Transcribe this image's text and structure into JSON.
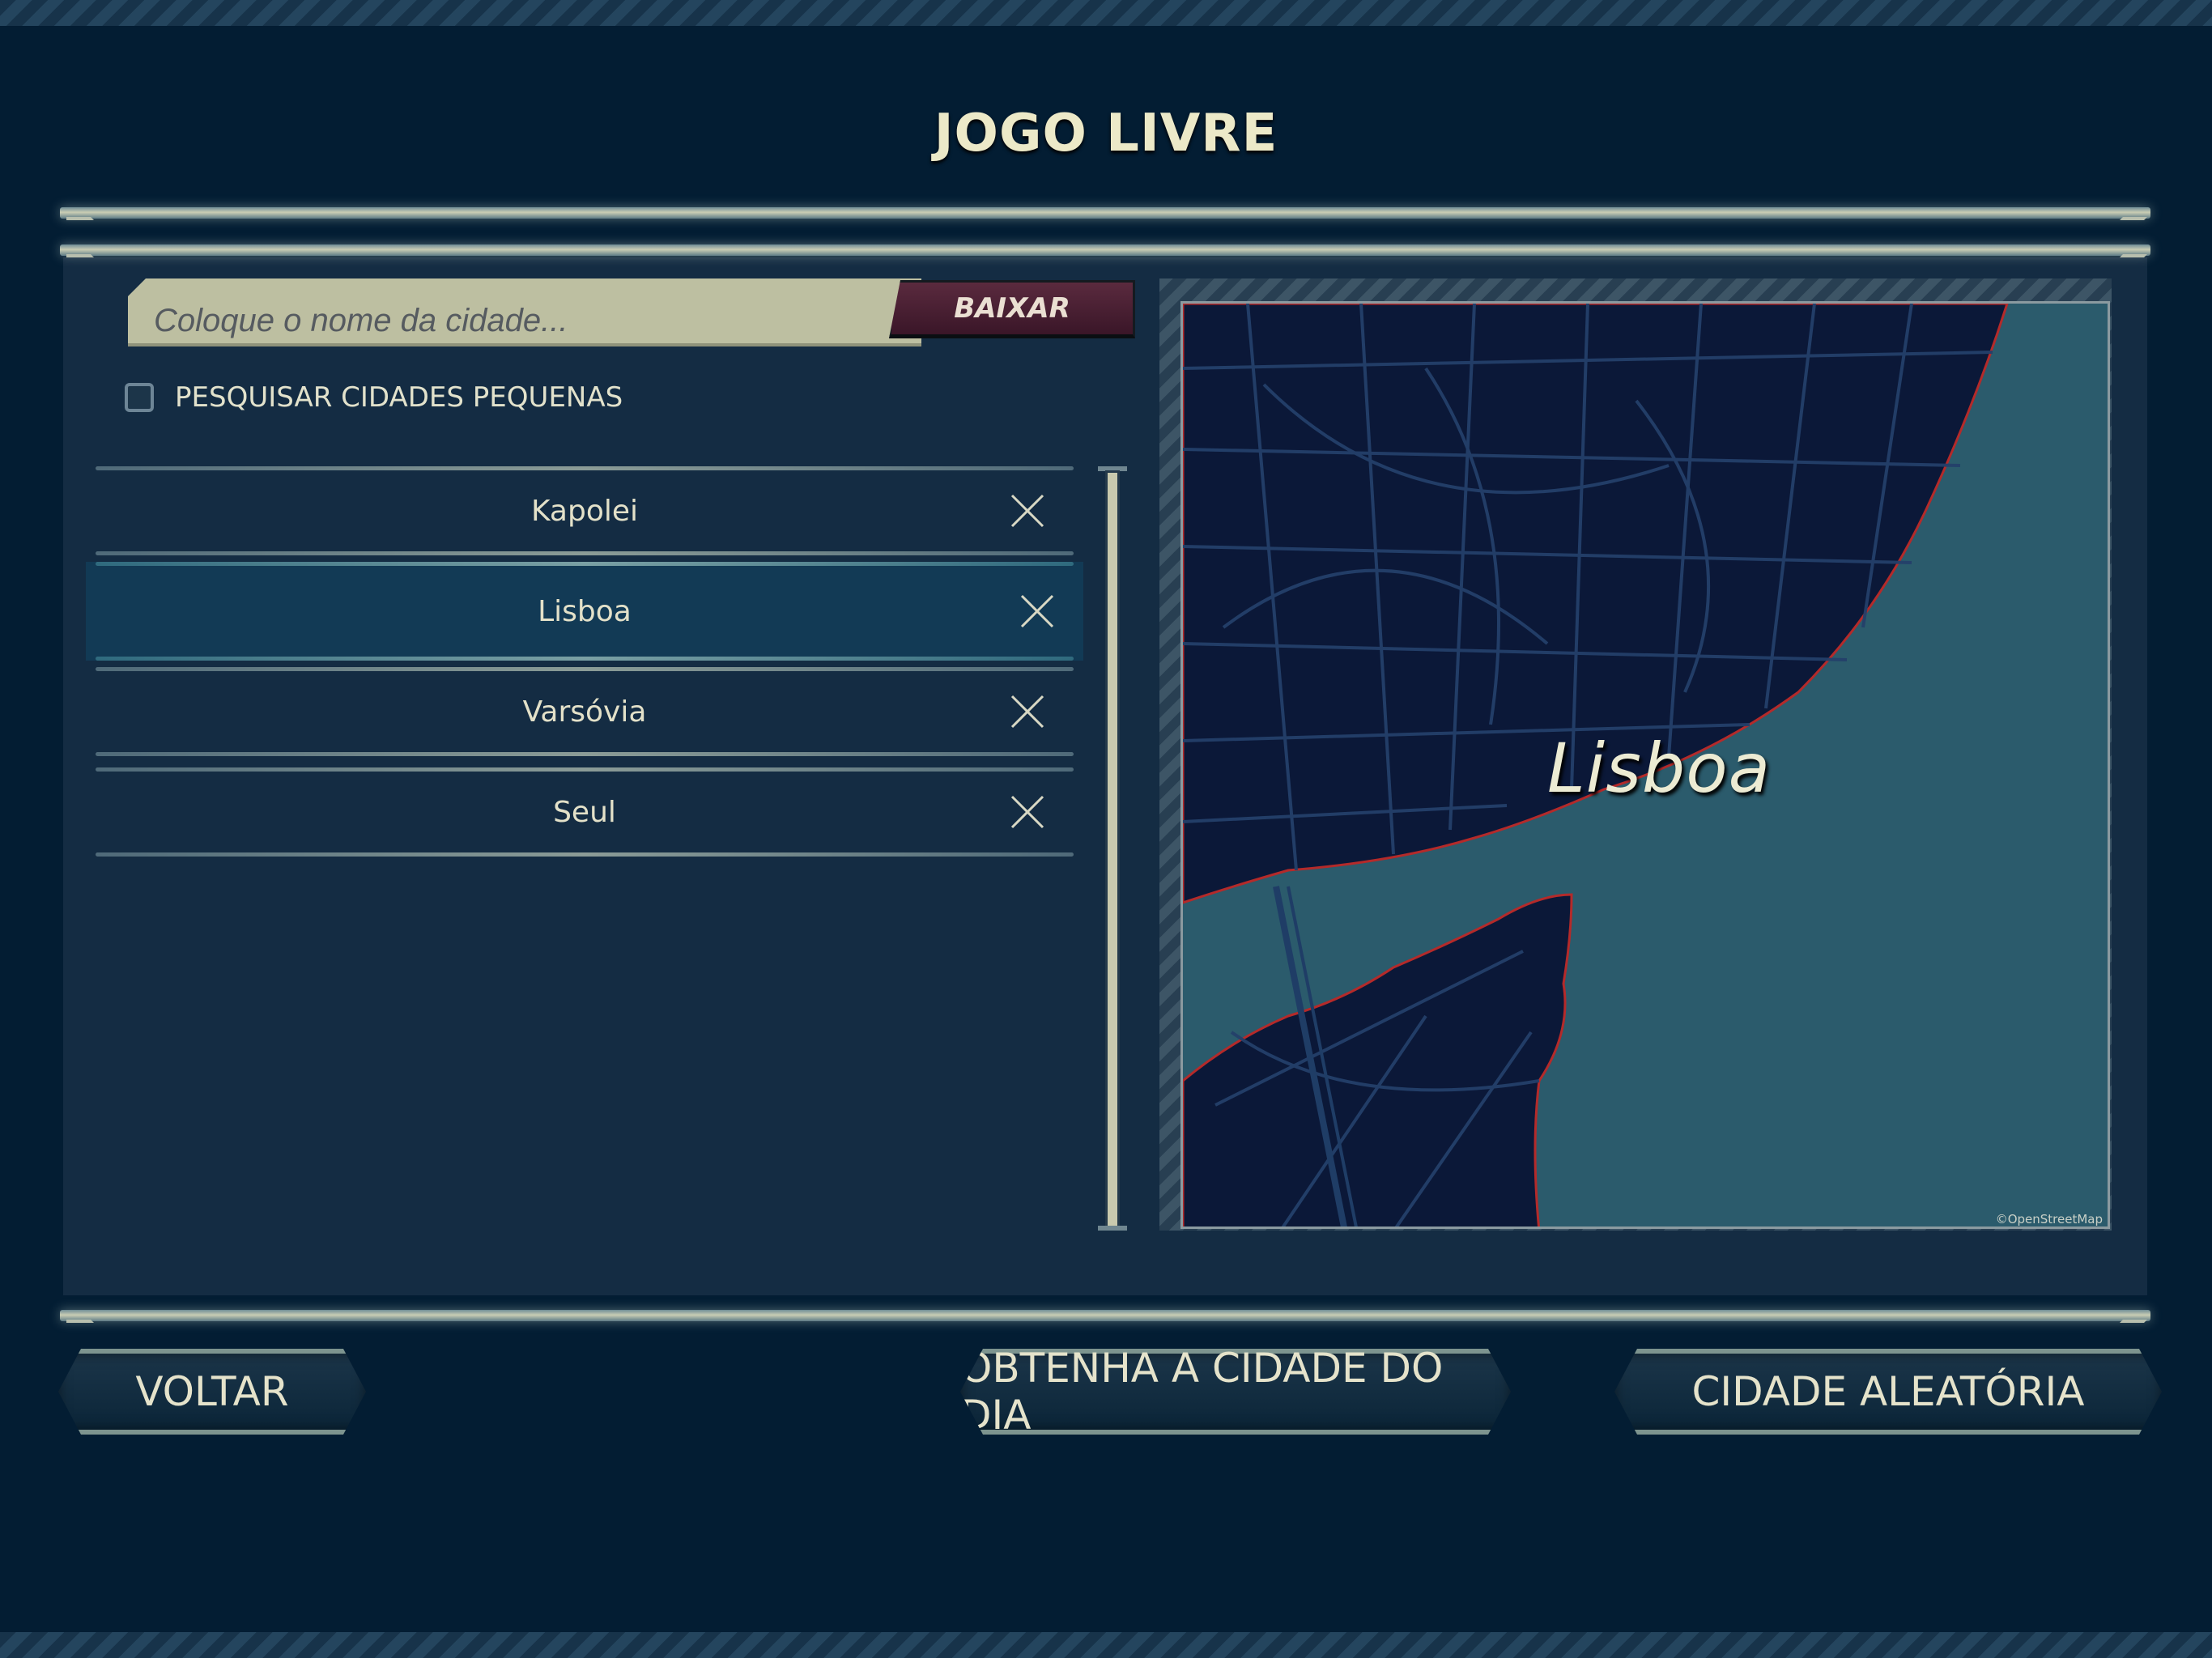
{
  "title": "JOGO LIVRE",
  "search": {
    "placeholder": "Coloque o nome da cidade...",
    "download_label": "BAIXAR"
  },
  "small_cities_checkbox": {
    "label": "PESQUISAR CIDADES PEQUENAS",
    "checked": false
  },
  "city_list": [
    {
      "name": "Kapolei",
      "selected": false
    },
    {
      "name": "Lisboa",
      "selected": true
    },
    {
      "name": "Varsóvia",
      "selected": false
    },
    {
      "name": "Seul",
      "selected": false
    }
  ],
  "map": {
    "city_label": "Lisboa",
    "attribution": "©OpenStreetMap",
    "colors": {
      "land": "#0b1838",
      "water": "#2b5b6c",
      "roads": "#243f69",
      "coast": "#b42a2a"
    }
  },
  "footer": {
    "back_label": "VOLTAR",
    "city_of_day_label": "OBTENHA A CIDADE DO DIA",
    "random_city_label": "CIDADE ALEATÓRIA"
  }
}
